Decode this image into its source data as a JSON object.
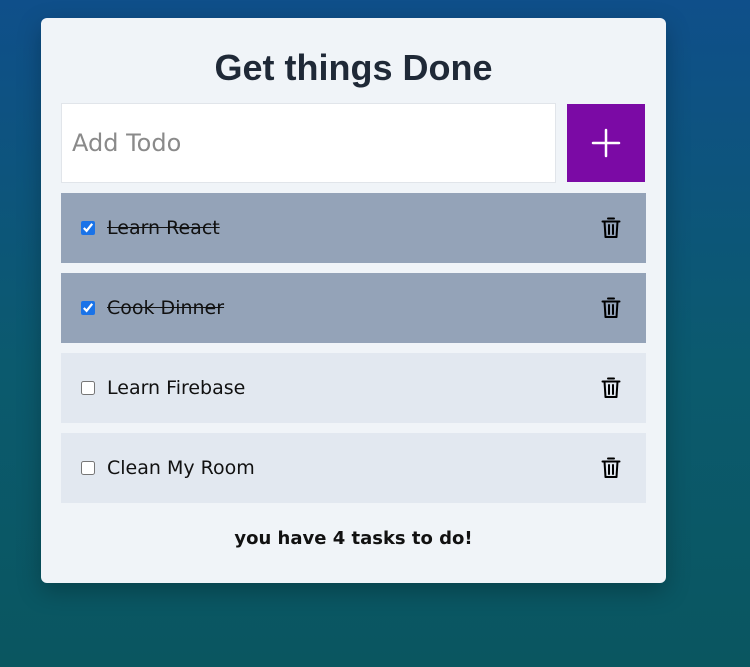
{
  "app": {
    "title": "Get things Done"
  },
  "input": {
    "placeholder": "Add Todo",
    "value": ""
  },
  "add_button": {
    "icon": "plus-icon"
  },
  "todos": [
    {
      "label": "Learn React",
      "completed": true
    },
    {
      "label": "Cook Dinner",
      "completed": true
    },
    {
      "label": "Learn Firebase",
      "completed": false
    },
    {
      "label": "Clean My Room",
      "completed": false
    }
  ],
  "footer": {
    "message": "you have 4 tasks to do!"
  },
  "colors": {
    "accent": "#7b0aa5",
    "completed_row": "#94a3b8",
    "pending_row": "#e2e8f0",
    "card": "#f0f4f8"
  },
  "icons": {
    "delete": "trash-icon"
  }
}
